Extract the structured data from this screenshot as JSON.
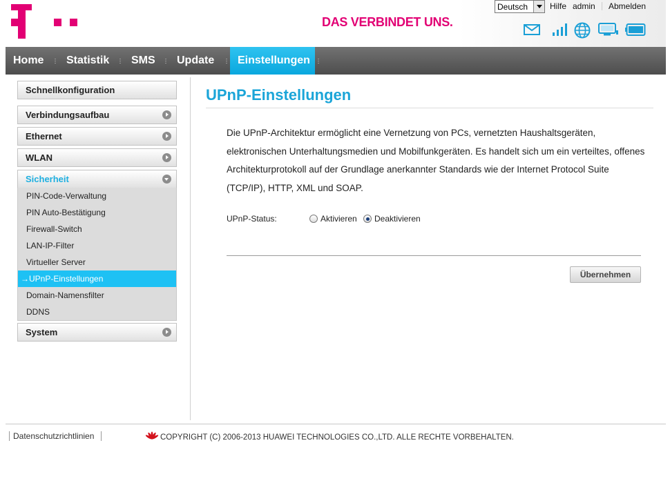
{
  "brand": {
    "slogan": "DAS VERBINDET UNS.",
    "accent_color": "#e20074",
    "highlight_color": "#1ec1f4"
  },
  "topbar": {
    "language": {
      "selected": "Deutsch"
    },
    "links": {
      "help": "Hilfe",
      "user": "admin",
      "logout": "Abmelden"
    },
    "status_icons": [
      "mail-icon",
      "signal-strength-icon",
      "globe-icon",
      "computer-icon",
      "battery-icon"
    ]
  },
  "nav": {
    "items": [
      {
        "label": "Home"
      },
      {
        "label": "Statistik"
      },
      {
        "label": "SMS"
      },
      {
        "label": "Update"
      },
      {
        "label": "Einstellungen"
      }
    ],
    "active": "Einstellungen"
  },
  "sidebar": {
    "quick_config": "Schnellkonfiguration",
    "sections": [
      {
        "label": "Verbindungsaufbau"
      },
      {
        "label": "Ethernet"
      },
      {
        "label": "WLAN"
      },
      {
        "label": "Sicherheit"
      },
      {
        "label": "System"
      }
    ],
    "security_items": [
      {
        "label": "PIN-Code-Verwaltung"
      },
      {
        "label": "PIN Auto-Bestätigung"
      },
      {
        "label": "Firewall-Switch"
      },
      {
        "label": "LAN-IP-Filter"
      },
      {
        "label": "Virtueller Server"
      },
      {
        "label": "→UPnP-Einstellungen"
      },
      {
        "label": "Domain-Namensfilter"
      },
      {
        "label": "DDNS"
      }
    ]
  },
  "main": {
    "title": "UPnP-Einstellungen",
    "description": "Die UPnP-Architektur ermöglicht eine Vernetzung von PCs, vernetzten Haushaltsgeräten, elektronischen Unterhaltungsmedien und Mobilfunkgeräten. Es handelt sich um ein verteiltes, offenes Architekturprotokoll auf der Grundlage anerkannter Standards wie der Internet Protocol Suite (TCP/IP), HTTP, XML und SOAP.",
    "status_label": "UPnP-Status:",
    "options": {
      "enable": "Aktivieren",
      "disable": "Deaktivieren"
    },
    "selected_option": "Deaktivieren",
    "apply_label": "Übernehmen"
  },
  "footer": {
    "privacy_link": "Datenschutzrichtlinien",
    "copyright": "COPYRIGHT (C) 2006-2013 HUAWEI TECHNOLOGIES CO.,LTD. ALLE RECHTE VORBEHALTEN."
  }
}
